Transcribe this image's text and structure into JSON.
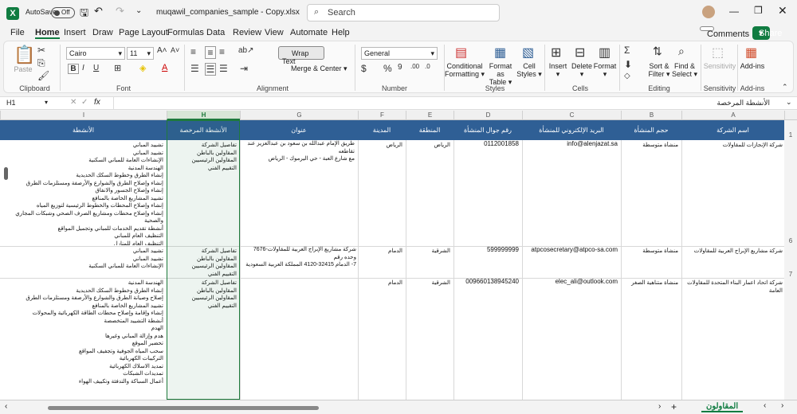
{
  "titlebar": {
    "autosave": "AutoSave",
    "autosave_state": "Off",
    "filename": "muqawil_companies_sample - Copy.xlsx",
    "search_placeholder": "Search"
  },
  "menu": [
    "File",
    "Home",
    "Insert",
    "Draw",
    "Page Layout",
    "Formulas",
    "Data",
    "Review",
    "View",
    "Automate",
    "Help"
  ],
  "active_tab": "Home",
  "comments_label": "Comments",
  "share_label": "Share",
  "ribbon": {
    "paste": "Paste",
    "font_name": "Cairo",
    "font_size": "11",
    "wrap_text": "Wrap Text",
    "merge_center": "Merge & Center",
    "number_format": "General",
    "conditional": "Conditional",
    "formatting": "Formatting",
    "format_as": "Format as",
    "table": "Table",
    "cell": "Cell",
    "styles_btn": "Styles",
    "insert": "Insert",
    "delete": "Delete",
    "format": "Format",
    "sort": "Sort &",
    "filter": "Filter",
    "find": "Find &",
    "select": "Select",
    "sensitivity": "Sensitivity",
    "addins": "Add-ins",
    "groups": {
      "clipboard": "Clipboard",
      "font": "Font",
      "alignment": "Alignment",
      "number": "Number",
      "styles": "Styles",
      "cells": "Cells",
      "editing": "Editing",
      "sensitivity": "Sensitivity",
      "addins": "Add-ins"
    }
  },
  "formula_bar": {
    "name_box": "H1",
    "fx": "fx",
    "content": "الأنشطة المرخصة"
  },
  "columns": [
    "I",
    "H",
    "G",
    "F",
    "E",
    "D",
    "C",
    "B",
    "A"
  ],
  "header_row": {
    "I": "الأنشطة",
    "H": "الأنشطة المرخصة",
    "G": "عنوان",
    "F": "المدينة",
    "E": "المنطقة",
    "D": "رقم جوال المنشأة",
    "C": "البريد الإلكتروني للمنشأة",
    "B": "حجم المنشأة",
    "A": "اسم الشركة"
  },
  "row_numbers": [
    "1",
    "6",
    "7"
  ],
  "rows": [
    {
      "A": "شركة الإنجازات للمقاولات",
      "B": "منشأة متوسطة",
      "C": "info@alenjazat.sa",
      "D": "0112001858",
      "E": "الرياض",
      "F": "الرياض",
      "G": "طريق الإمام عبدالله بن سعود بن عبدالعزيز عند تقاطعه\nمع شارع العبة - حي اليرموك - الرياض",
      "H": "تفاصيل الشركة\nالمقاولين بالباطن\nالمقاولين الرئيسيين\nالتقييم الفني",
      "I": "تشييد المباني\nتشييد المباني\nالإنشاءات العامة للمباني السكنية\nالهندسة المدنية\nإنشاء الطرق وخطوط السكك الحديدية\nإنشاء وإصلاح الطرق والشوارع والأرصفة ومستلزمات الطرق\nإنشاء وإصلاح الجسور والانفاق\nتشييد المشاريع الخاصة بالمنافع\nإنشاء وإصلاح المحطات والخطوط الرئيسية لتوزيع المياه\nإنشاء وإصلاح محطات ومشاريع الصرف الصحي وشبكات المجاري والصحية\nأنشطة تقديم الخدمات للمباني وتجميل المواقع\nالتنظيف العام للمباني\nالتنظيف العام للمنازل"
    },
    {
      "A": "شركة مشاريع الإبراج العربية للمقاولات",
      "B": "منشأة متوسطة",
      "C": "atpcosecretary@atpco-sa.com",
      "D": "599999999",
      "E": "الشرقية",
      "F": "الدمام",
      "G": "شركة مشاريع الإبراج العربية للمقاولات-7676 وحده رقم\n7- الدمام 32415-4120 المملكة العربية السعودية",
      "H": "تفاصيل الشركة\nالمقاولين بالباطن\nالمقاولين الرئيسيين\nالتقييم الفني",
      "I": "تشييد المباني\nتشييد المباني\nالإنشاءات العامة للمباني السكنية"
    },
    {
      "A": "شركة اتحاد اعمار البناء المتحدة للمقاولات العامة",
      "B": "منشأة متناهية الصغر",
      "C": "elec_ali@outlook.com",
      "D": "009660138945240",
      "E": "الشرقية",
      "F": "الدمام",
      "G": "",
      "H": "تفاصيل الشركة\nالمقاولين بالباطن\nالمقاولين الرئيسيين\nالتقييم الفني",
      "I": "الهندسة المدنية\nإنشاء الطرق وخطوط السكك الحديدية\nإصلاح وصيانة الطرق والشوارع والأرصفة ومستلزمات الطرق\nتشييد المشاريع الخاصة بالمنافع\nإنشاء وإقامة وإصلاح محطات الطاقة الكهربائية والمحولات\nأنشطة التشييد المتخصصة\nالهدم\nهدم وإزالة المباني وغيرها\nتحضير الموقع\nسحب المياه الجوفية وتجفيف المواقع\nالتركيبات الكهربائية\nتمديد الاسلاك الكهربائية\nتمديدات الشبكات\nأعمال السباكة والتدفئة وتكييف الهواء"
    }
  ],
  "sheet_tab": "المقاولون",
  "add_sheet": "+"
}
